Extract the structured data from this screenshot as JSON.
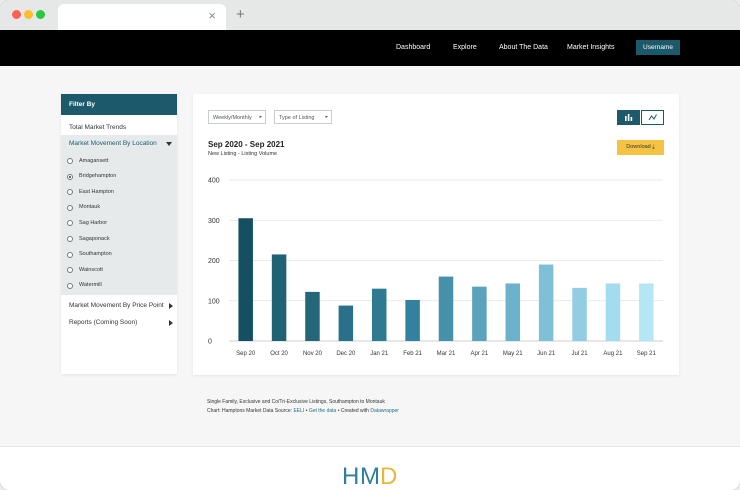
{
  "browser": {
    "tab_close": "×",
    "new_tab": "+"
  },
  "nav": {
    "items": [
      "Dashboard",
      "Explore",
      "About The Data",
      "Market Insights"
    ],
    "username": "Username"
  },
  "sidebar": {
    "title": "Filter By",
    "total": "Total Market Trends",
    "location": "Market Movement By Location",
    "locations": [
      "Amagansett",
      "Bridgehampton",
      "East Hampton",
      "Montauk",
      "Sag Harbor",
      "Sagaponack",
      "Southampton",
      "Wainscott",
      "Watermill"
    ],
    "selected_location": "Bridgehampton",
    "price_point": "Market Movement By Price Point",
    "reports": "Reports (Coming Soon)"
  },
  "controls": {
    "period": "Weekly/Monthly",
    "listing_type": "Type of Listing",
    "download": "Download",
    "view_mode": "bar"
  },
  "chart_data": {
    "type": "bar",
    "title": "Sep 2020 - Sep 2021",
    "subtitle": "New Listing - Listing Volume",
    "categories": [
      "Sep 20",
      "Oct 20",
      "Nov 20",
      "Dec 20",
      "Jan 21",
      "Feb 21",
      "Mar 21",
      "Apr 21",
      "May 21",
      "Jun 21",
      "Jul 21",
      "Aug 21",
      "Sep 21"
    ],
    "values": [
      305,
      215,
      122,
      88,
      130,
      102,
      160,
      135,
      143,
      190,
      132,
      143,
      143
    ],
    "ylim": [
      0,
      400
    ],
    "yticks": [
      0,
      100,
      200,
      300,
      400
    ],
    "colors": [
      "#14505f",
      "#1f6273",
      "#24667a",
      "#29708a",
      "#2d7a91",
      "#3381a0",
      "#4690aa",
      "#5ba3bd",
      "#6db2cd",
      "#7fc0d8",
      "#92cde3",
      "#a3dbef",
      "#b4e6f6"
    ],
    "grid": true
  },
  "footnotes": {
    "line1": "Single Family, Exclusive and Co/Tri-Exclusive Listings, Southampton to Montauk",
    "line2_prefix": "Chart: Hamptons Market Data Source: ",
    "src_link": "EELI",
    "sep1": " • ",
    "getdata": "Get the data",
    "sep2": " • Created with ",
    "dw": "Datawrapper"
  },
  "logo": "HMD"
}
